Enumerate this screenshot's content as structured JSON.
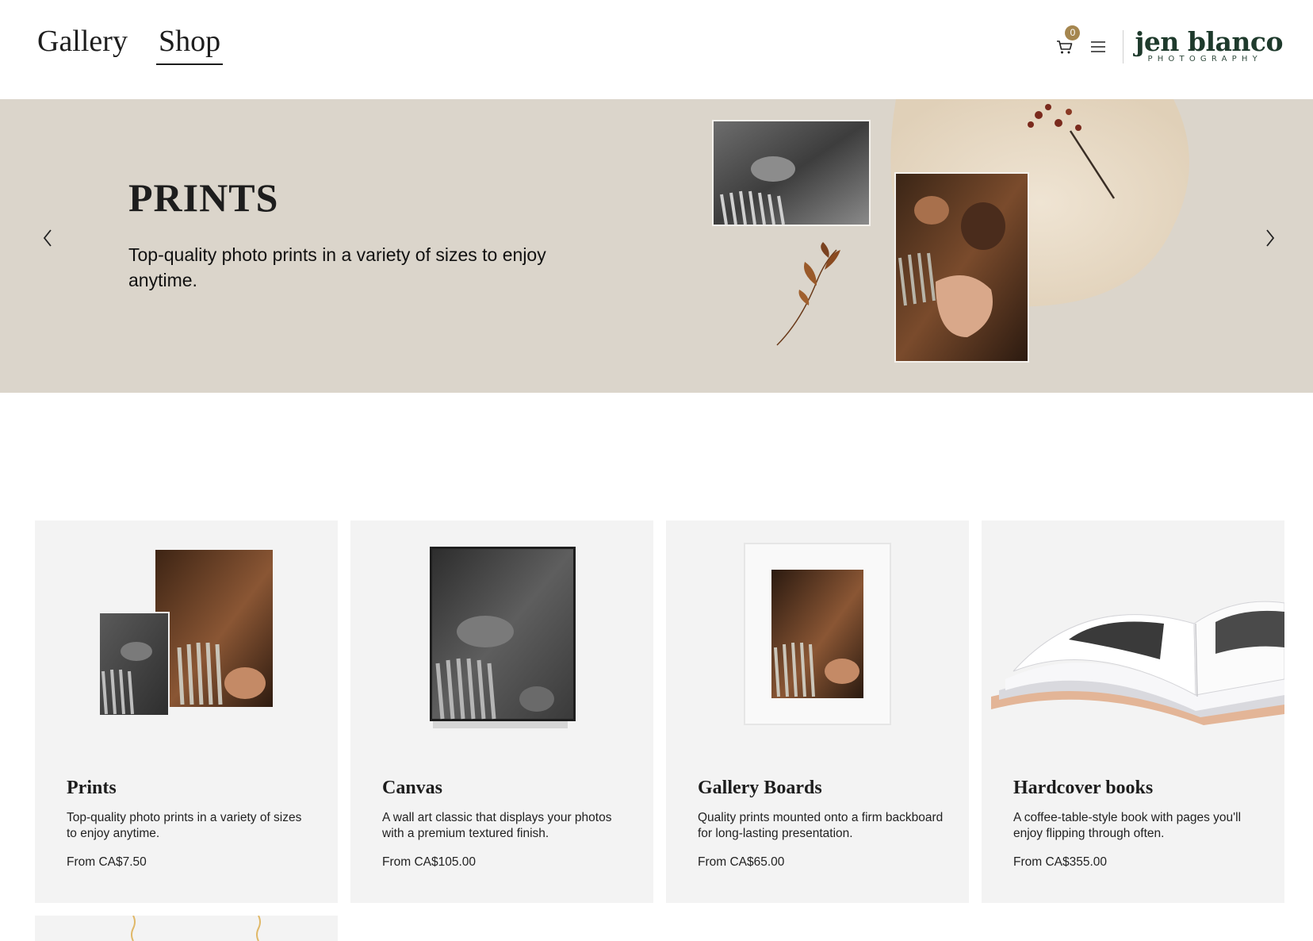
{
  "nav": {
    "items": [
      {
        "label": "Gallery",
        "active": false
      },
      {
        "label": "Shop",
        "active": true
      }
    ]
  },
  "header": {
    "cart_count": "0",
    "cart_icon": "cart-icon",
    "menu_icon": "hamburger-menu-icon",
    "logo_main": "jen blanco",
    "logo_sub": "PHOTOGRAPHY",
    "brand_color": "#1e3a2c",
    "badge_color": "#a5864f"
  },
  "hero": {
    "title": "PRINTS",
    "subtitle": "Top-quality photo prints in a variety of sizes to enjoy anytime.",
    "prev_icon": "chevron-left-icon",
    "next_icon": "chevron-right-icon",
    "background": "#dbd5cb"
  },
  "products": [
    {
      "title": "Prints",
      "description": "Top-quality photo prints in a variety of sizes to enjoy anytime.",
      "price": "From CA$7.50"
    },
    {
      "title": "Canvas",
      "description": "A wall art classic that displays your photos with a premium textured finish.",
      "price": "From CA$105.00"
    },
    {
      "title": "Gallery Boards",
      "description": "Quality prints mounted onto a firm backboard for long-lasting presentation.",
      "price": "From CA$65.00"
    },
    {
      "title": "Hardcover books",
      "description": "A coffee-table-style book with pages you'll enjoy flipping through often.",
      "price": "From CA$355.00"
    }
  ]
}
